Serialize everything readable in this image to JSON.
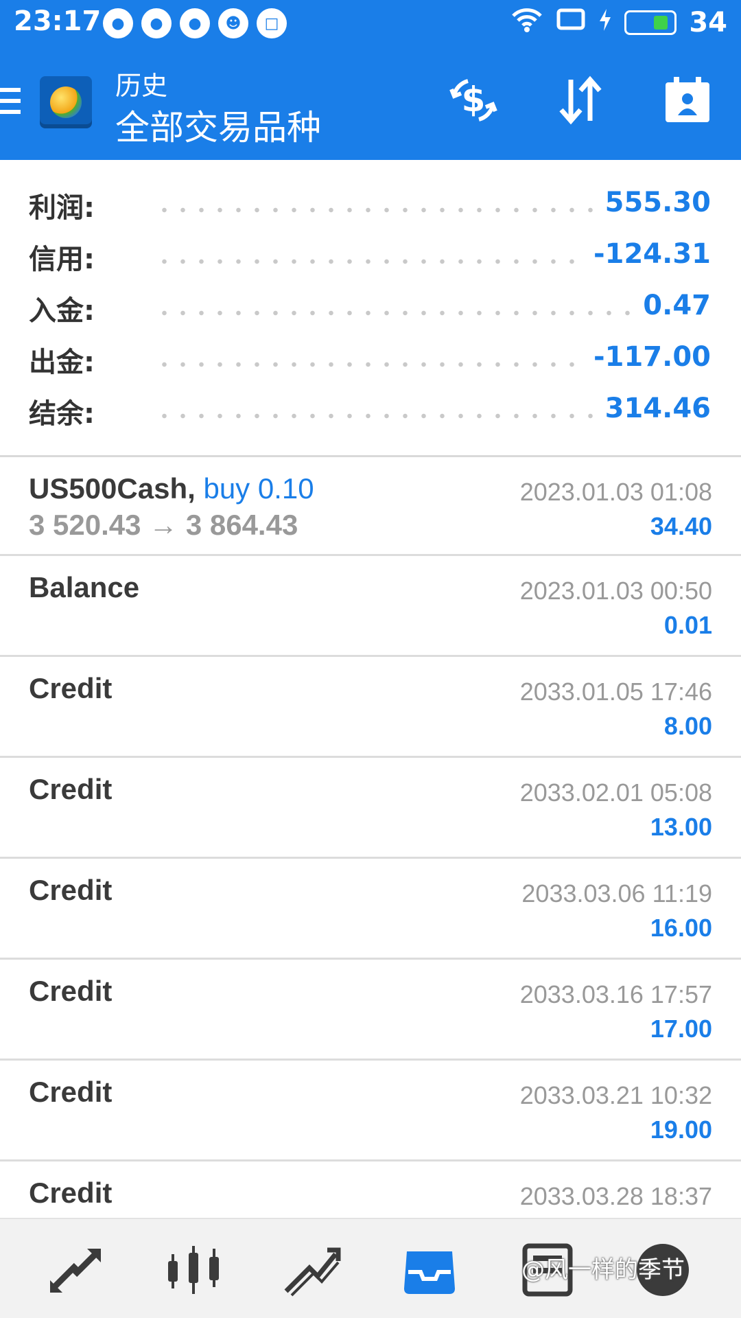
{
  "status_bar": {
    "time": "23:17",
    "battery_level": "34"
  },
  "header": {
    "subtitle": "历史",
    "title": "全部交易品种"
  },
  "summary": [
    {
      "label": "利润:",
      "value": "555.30"
    },
    {
      "label": "信用:",
      "value": "-124.31"
    },
    {
      "label": "入金:",
      "value": "0.47"
    },
    {
      "label": "出金:",
      "value": "-117.00"
    },
    {
      "label": "结余:",
      "value": "314.46"
    }
  ],
  "trade": {
    "symbol": "US500Cash,",
    "deal": "buy 0.10",
    "prices": "3 520.43 → 3 864.43",
    "time": "2023.01.03 01:08",
    "amount": "34.40"
  },
  "history": [
    {
      "type": "Balance",
      "time": "2023.01.03 00:50",
      "amount": "0.01"
    },
    {
      "type": "Credit",
      "time": "2033.01.05 17:46",
      "amount": "8.00"
    },
    {
      "type": "Credit",
      "time": "2033.02.01 05:08",
      "amount": "13.00"
    },
    {
      "type": "Credit",
      "time": "2033.03.06 11:19",
      "amount": "16.00"
    },
    {
      "type": "Credit",
      "time": "2033.03.16 17:57",
      "amount": "17.00"
    },
    {
      "type": "Credit",
      "time": "2033.03.21 10:32",
      "amount": "19.00"
    },
    {
      "type": "Credit",
      "time": "2033.03.28 18:37",
      "amount": ""
    }
  ],
  "watermark": "@风一样的季节",
  "colors": {
    "accent": "#1a7ee8",
    "value_blue": "#1a7ee8",
    "muted": "#999999"
  }
}
